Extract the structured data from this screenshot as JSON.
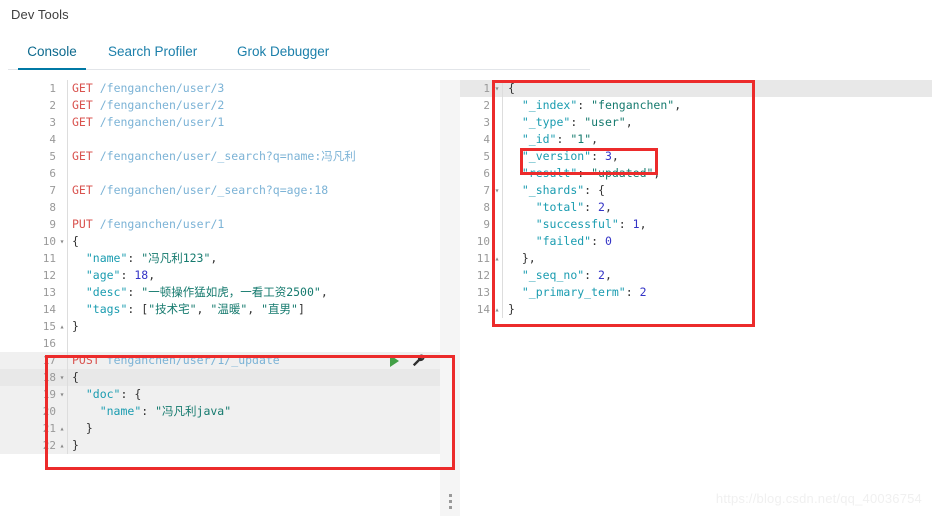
{
  "app": {
    "title": "Dev Tools",
    "watermark": "https://blog.csdn.net/qq_40036754"
  },
  "tabs": [
    {
      "id": "console",
      "label": "Console",
      "active": true
    },
    {
      "id": "profiler",
      "label": "Search Profiler",
      "active": false
    },
    {
      "id": "grok",
      "label": "Grok Debugger",
      "active": false
    }
  ],
  "colors": {
    "accent": "#0079a5",
    "annotation": "#ec2b2b",
    "method": "#d9534f",
    "url": "#7cb3d6",
    "key": "#1a9cb0",
    "string": "#157a6e",
    "number": "#3434c6",
    "run_icon": "#43a047"
  },
  "request_editor": {
    "name": "console-request-editor",
    "active_line": 18,
    "lines": [
      {
        "n": 1,
        "fold": "",
        "tokens": [
          {
            "t": "method",
            "v": "GET"
          },
          {
            "t": "sp",
            "v": " "
          },
          {
            "t": "url",
            "v": "/fenganchen/user/3"
          }
        ]
      },
      {
        "n": 2,
        "fold": "",
        "tokens": [
          {
            "t": "method",
            "v": "GET"
          },
          {
            "t": "sp",
            "v": " "
          },
          {
            "t": "url",
            "v": "/fenganchen/user/2"
          }
        ]
      },
      {
        "n": 3,
        "fold": "",
        "tokens": [
          {
            "t": "method",
            "v": "GET"
          },
          {
            "t": "sp",
            "v": " "
          },
          {
            "t": "url",
            "v": "/fenganchen/user/1"
          }
        ]
      },
      {
        "n": 4,
        "fold": "",
        "tokens": []
      },
      {
        "n": 5,
        "fold": "",
        "tokens": [
          {
            "t": "method",
            "v": "GET"
          },
          {
            "t": "sp",
            "v": " "
          },
          {
            "t": "url",
            "v": "/fenganchen/user/_search?q=name:冯凡利"
          }
        ]
      },
      {
        "n": 6,
        "fold": "",
        "tokens": []
      },
      {
        "n": 7,
        "fold": "",
        "tokens": [
          {
            "t": "method",
            "v": "GET"
          },
          {
            "t": "sp",
            "v": " "
          },
          {
            "t": "url",
            "v": "/fenganchen/user/_search?q=age:18"
          }
        ]
      },
      {
        "n": 8,
        "fold": "",
        "tokens": []
      },
      {
        "n": 9,
        "fold": "",
        "tokens": [
          {
            "t": "method",
            "v": "PUT"
          },
          {
            "t": "sp",
            "v": " "
          },
          {
            "t": "url",
            "v": "/fenganchen/user/1"
          }
        ]
      },
      {
        "n": 10,
        "fold": "▾",
        "tokens": [
          {
            "t": "punc",
            "v": "{"
          }
        ]
      },
      {
        "n": 11,
        "fold": "",
        "tokens": [
          {
            "t": "sp",
            "v": "  "
          },
          {
            "t": "key",
            "v": "\"name\""
          },
          {
            "t": "punc",
            "v": ": "
          },
          {
            "t": "str",
            "v": "\"冯凡利123\""
          },
          {
            "t": "punc",
            "v": ","
          }
        ]
      },
      {
        "n": 12,
        "fold": "",
        "tokens": [
          {
            "t": "sp",
            "v": "  "
          },
          {
            "t": "key",
            "v": "\"age\""
          },
          {
            "t": "punc",
            "v": ": "
          },
          {
            "t": "num",
            "v": "18"
          },
          {
            "t": "punc",
            "v": ","
          }
        ]
      },
      {
        "n": 13,
        "fold": "",
        "tokens": [
          {
            "t": "sp",
            "v": "  "
          },
          {
            "t": "key",
            "v": "\"desc\""
          },
          {
            "t": "punc",
            "v": ": "
          },
          {
            "t": "str",
            "v": "\"一顿操作猛如虎，一看工资2500\""
          },
          {
            "t": "punc",
            "v": ","
          }
        ]
      },
      {
        "n": 14,
        "fold": "",
        "tokens": [
          {
            "t": "sp",
            "v": "  "
          },
          {
            "t": "key",
            "v": "\"tags\""
          },
          {
            "t": "punc",
            "v": ": ["
          },
          {
            "t": "str",
            "v": "\"技术宅\""
          },
          {
            "t": "punc",
            "v": ", "
          },
          {
            "t": "str",
            "v": "\"温暖\""
          },
          {
            "t": "punc",
            "v": ", "
          },
          {
            "t": "str",
            "v": "\"直男\""
          },
          {
            "t": "punc",
            "v": "]"
          }
        ]
      },
      {
        "n": 15,
        "fold": "▴",
        "tokens": [
          {
            "t": "punc",
            "v": "}"
          }
        ]
      },
      {
        "n": 16,
        "fold": "",
        "tokens": []
      },
      {
        "n": 17,
        "fold": "",
        "shaded": true,
        "actions": true,
        "tokens": [
          {
            "t": "method",
            "v": "POST"
          },
          {
            "t": "sp",
            "v": " "
          },
          {
            "t": "url",
            "v": "fenganchen/user/1/_update"
          }
        ]
      },
      {
        "n": 18,
        "fold": "▾",
        "active": true,
        "tokens": [
          {
            "t": "punc",
            "v": "{"
          }
        ]
      },
      {
        "n": 19,
        "fold": "▾",
        "shaded": true,
        "tokens": [
          {
            "t": "sp",
            "v": "  "
          },
          {
            "t": "key",
            "v": "\"doc\""
          },
          {
            "t": "punc",
            "v": ": {"
          }
        ]
      },
      {
        "n": 20,
        "fold": "",
        "shaded": true,
        "tokens": [
          {
            "t": "sp",
            "v": "    "
          },
          {
            "t": "key",
            "v": "\"name\""
          },
          {
            "t": "punc",
            "v": ": "
          },
          {
            "t": "str",
            "v": "\"冯凡利java\""
          }
        ]
      },
      {
        "n": 21,
        "fold": "▴",
        "shaded": true,
        "tokens": [
          {
            "t": "sp",
            "v": "  "
          },
          {
            "t": "punc",
            "v": "}"
          }
        ]
      },
      {
        "n": 22,
        "fold": "▴",
        "shaded": true,
        "tokens": [
          {
            "t": "punc",
            "v": "}"
          }
        ]
      }
    ],
    "run_icon": "play-icon",
    "wrench_icon": "wrench-icon"
  },
  "response_editor": {
    "name": "console-response-viewer",
    "active_line": 1,
    "lines": [
      {
        "n": 1,
        "fold": "▾",
        "active": true,
        "tokens": [
          {
            "t": "punc",
            "v": "{"
          }
        ]
      },
      {
        "n": 2,
        "fold": "",
        "tokens": [
          {
            "t": "sp",
            "v": "  "
          },
          {
            "t": "key",
            "v": "\"_index\""
          },
          {
            "t": "punc",
            "v": ": "
          },
          {
            "t": "str",
            "v": "\"fenganchen\""
          },
          {
            "t": "punc",
            "v": ","
          }
        ]
      },
      {
        "n": 3,
        "fold": "",
        "tokens": [
          {
            "t": "sp",
            "v": "  "
          },
          {
            "t": "key",
            "v": "\"_type\""
          },
          {
            "t": "punc",
            "v": ": "
          },
          {
            "t": "str",
            "v": "\"user\""
          },
          {
            "t": "punc",
            "v": ","
          }
        ]
      },
      {
        "n": 4,
        "fold": "",
        "tokens": [
          {
            "t": "sp",
            "v": "  "
          },
          {
            "t": "key",
            "v": "\"_id\""
          },
          {
            "t": "punc",
            "v": ": "
          },
          {
            "t": "str",
            "v": "\"1\""
          },
          {
            "t": "punc",
            "v": ","
          }
        ]
      },
      {
        "n": 5,
        "fold": "",
        "tokens": [
          {
            "t": "sp",
            "v": "  "
          },
          {
            "t": "key",
            "v": "\"_version\""
          },
          {
            "t": "punc",
            "v": ": "
          },
          {
            "t": "num",
            "v": "3"
          },
          {
            "t": "punc",
            "v": ","
          }
        ]
      },
      {
        "n": 6,
        "fold": "",
        "tokens": [
          {
            "t": "sp",
            "v": "  "
          },
          {
            "t": "key",
            "v": "\"result\""
          },
          {
            "t": "punc",
            "v": ": "
          },
          {
            "t": "str",
            "v": "\"updated\""
          },
          {
            "t": "punc",
            "v": ","
          }
        ]
      },
      {
        "n": 7,
        "fold": "▾",
        "tokens": [
          {
            "t": "sp",
            "v": "  "
          },
          {
            "t": "key",
            "v": "\"_shards\""
          },
          {
            "t": "punc",
            "v": ": {"
          }
        ]
      },
      {
        "n": 8,
        "fold": "",
        "tokens": [
          {
            "t": "sp",
            "v": "    "
          },
          {
            "t": "key",
            "v": "\"total\""
          },
          {
            "t": "punc",
            "v": ": "
          },
          {
            "t": "num",
            "v": "2"
          },
          {
            "t": "punc",
            "v": ","
          }
        ]
      },
      {
        "n": 9,
        "fold": "",
        "tokens": [
          {
            "t": "sp",
            "v": "    "
          },
          {
            "t": "key",
            "v": "\"successful\""
          },
          {
            "t": "punc",
            "v": ": "
          },
          {
            "t": "num",
            "v": "1"
          },
          {
            "t": "punc",
            "v": ","
          }
        ]
      },
      {
        "n": 10,
        "fold": "",
        "tokens": [
          {
            "t": "sp",
            "v": "    "
          },
          {
            "t": "key",
            "v": "\"failed\""
          },
          {
            "t": "punc",
            "v": ": "
          },
          {
            "t": "num",
            "v": "0"
          }
        ]
      },
      {
        "n": 11,
        "fold": "▴",
        "tokens": [
          {
            "t": "sp",
            "v": "  "
          },
          {
            "t": "punc",
            "v": "},"
          }
        ]
      },
      {
        "n": 12,
        "fold": "",
        "tokens": [
          {
            "t": "sp",
            "v": "  "
          },
          {
            "t": "key",
            "v": "\"_seq_no\""
          },
          {
            "t": "punc",
            "v": ": "
          },
          {
            "t": "num",
            "v": "2"
          },
          {
            "t": "punc",
            "v": ","
          }
        ]
      },
      {
        "n": 13,
        "fold": "",
        "tokens": [
          {
            "t": "sp",
            "v": "  "
          },
          {
            "t": "key",
            "v": "\"_primary_term\""
          },
          {
            "t": "punc",
            "v": ": "
          },
          {
            "t": "num",
            "v": "2"
          }
        ]
      },
      {
        "n": 14,
        "fold": "▴",
        "tokens": [
          {
            "t": "punc",
            "v": "}"
          }
        ]
      }
    ]
  },
  "annotations": [
    {
      "id": "annot-post",
      "label": "post-update-request-highlight"
    },
    {
      "id": "annot-response",
      "label": "response-body-highlight"
    },
    {
      "id": "annot-version",
      "label": "version-field-highlight"
    }
  ]
}
